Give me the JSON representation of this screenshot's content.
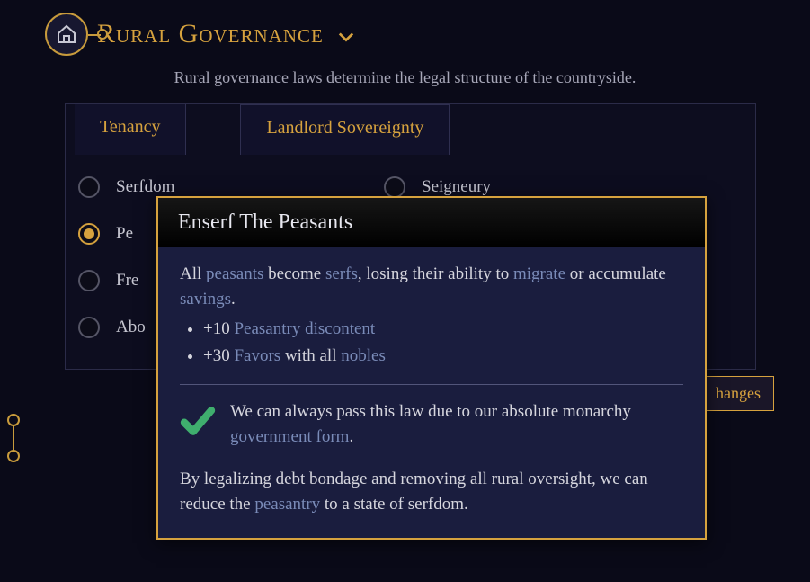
{
  "header": {
    "title": "Rural Governance",
    "icon": "house-icon"
  },
  "subtitle": "Rural governance laws determine the legal structure of the countryside.",
  "tabs": {
    "tenancy": {
      "label": "Tenancy"
    },
    "landlord": {
      "label": "Landlord Sovereignty"
    }
  },
  "tenancy_options": [
    {
      "label": "Serfdom",
      "selected": false
    },
    {
      "label": "Pe",
      "selected": true
    },
    {
      "label": "Fre",
      "selected": false
    },
    {
      "label": "Abo",
      "selected": false
    }
  ],
  "landlord_options": [
    {
      "label": "Seigneury",
      "selected": false
    }
  ],
  "propose_button": "hanges",
  "tooltip": {
    "title": "Enserf The Peasants",
    "line1_pre": "All ",
    "line1_link1": "peasants",
    "line1_mid": " become ",
    "line1_link2": "serfs",
    "line1_post": ", losing their ability to ",
    "line2_link1": "migrate",
    "line2_mid": " or accumulate ",
    "line2_link2": "savings",
    "line2_end": ".",
    "bullet1_pre": "+10 ",
    "bullet1_link": "Peasantry discontent",
    "bullet2_pre": "+30 ",
    "bullet2_link1": "Favors",
    "bullet2_mid": " with all ",
    "bullet2_link2": "nobles",
    "check_pre": "We can always pass this law due to our absolute monarchy ",
    "check_link": "government form",
    "check_end": ".",
    "flavor_pre": "By legalizing debt bondage and removing all rural oversight, we can reduce the ",
    "flavor_link": "peasantry",
    "flavor_post": " to a state of serfdom."
  }
}
